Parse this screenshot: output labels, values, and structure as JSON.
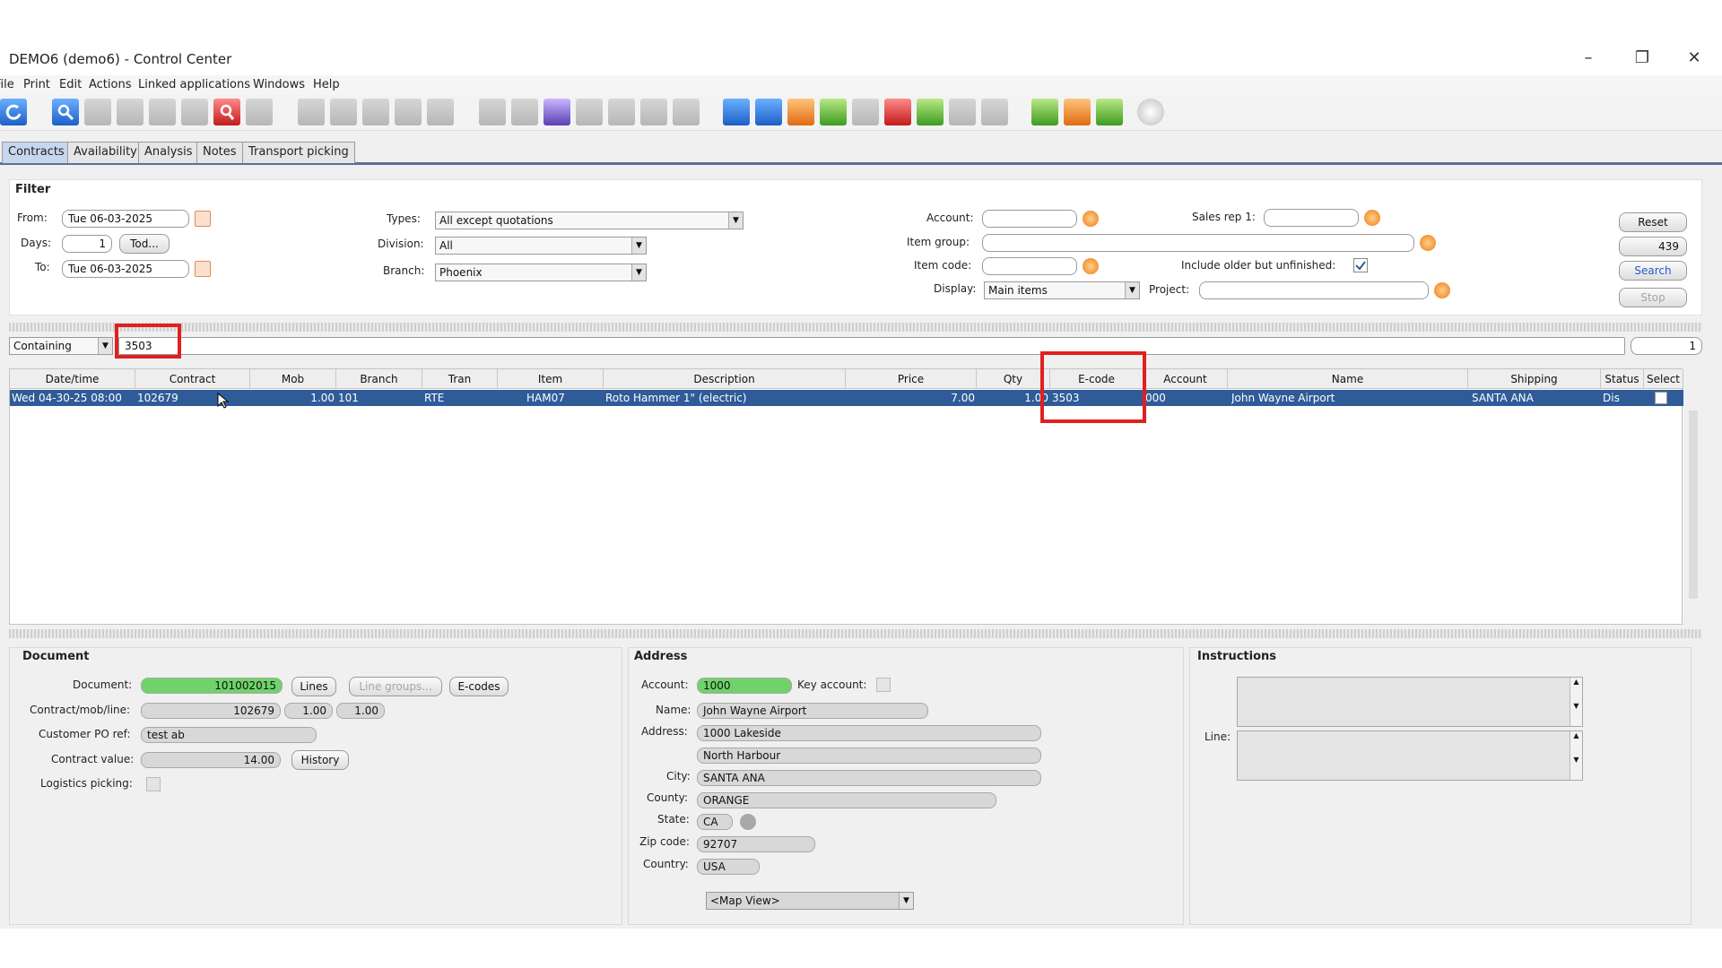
{
  "window": {
    "title": "DEMO6 (demo6) - Control Center"
  },
  "menu": [
    "File",
    "Print",
    "Edit",
    "Actions",
    "Linked applications",
    "Windows",
    "Help"
  ],
  "tabs": [
    {
      "label": "Contracts",
      "active": true
    },
    {
      "label": "Availability"
    },
    {
      "label": "Analysis"
    },
    {
      "label": "Notes"
    },
    {
      "label": "Transport picking"
    }
  ],
  "filter": {
    "title": "Filter",
    "from_label": "From:",
    "from_value": "Tue 06-03-2025",
    "days_label": "Days:",
    "days_value": "1",
    "today_label": "Tod...",
    "to_label": "To:",
    "to_value": "Tue 06-03-2025",
    "types_label": "Types:",
    "types_value": "All except quotations",
    "division_label": "Division:",
    "division_value": "All",
    "branch_label": "Branch:",
    "branch_value": "Phoenix",
    "account_label": "Account:",
    "account_value": "",
    "item_group_label": "Item group:",
    "item_group_value": "",
    "item_code_label": "Item code:",
    "item_code_value": "",
    "display_label": "Display:",
    "display_value": "Main items",
    "sales_rep_label": "Sales rep 1:",
    "sales_rep_value": "",
    "include_older_label": "Include older but unfinished:",
    "include_older_checked": true,
    "project_label": "Project:",
    "project_value": "",
    "reset_label": "Reset",
    "count_value": "439",
    "search_label": "Search",
    "stop_label": "Stop"
  },
  "search": {
    "mode": "Containing",
    "query": "3503",
    "page": "1"
  },
  "grid": {
    "columns": [
      "Date/time",
      "Contract",
      "Mob",
      "Branch",
      "Tran",
      "Item",
      "Description",
      "Price",
      "Qty",
      "E-code",
      "Account",
      "Name",
      "Shipping",
      "Status",
      "Select"
    ],
    "rows": [
      {
        "datetime": "Wed 04-30-25 08:00",
        "contract": "102679",
        "mob": "1.00",
        "branch": "101",
        "tran": "RTE",
        "item": "HAM07",
        "description": "Roto Hammer 1\" (electric)",
        "price": "7.00",
        "qty": "1.00",
        "ecode": "3503",
        "account": "000",
        "name": "John Wayne Airport",
        "shipping": "SANTA ANA",
        "status": "Dis"
      }
    ]
  },
  "document": {
    "title": "Document",
    "document_label": "Document:",
    "document_value": "101002015",
    "lines_label": "Lines",
    "line_groups_label": "Line groups...",
    "ecodes_label": "E-codes",
    "cml_label": "Contract/mob/line:",
    "contract_value": "102679",
    "mob_value": "1.00",
    "line_value": "1.00",
    "po_label": "Customer PO ref:",
    "po_value": "test ab",
    "value_label": "Contract value:",
    "value_value": "14.00",
    "history_label": "History",
    "logistics_label": "Logistics picking:"
  },
  "address": {
    "title": "Address",
    "account_label": "Account:",
    "account_value": "1000",
    "key_account_label": "Key account:",
    "name_label": "Name:",
    "name_value": "John Wayne Airport",
    "address_label": "Address:",
    "address1": "1000 Lakeside",
    "address2": "North Harbour",
    "city_label": "City:",
    "city_value": "SANTA ANA",
    "county_label": "County:",
    "county_value": "ORANGE",
    "state_label": "State:",
    "state_value": "CA",
    "zip_label": "Zip code:",
    "zip_value": "92707",
    "country_label": "Country:",
    "country_value": "USA",
    "map_view": "<Map View>"
  },
  "instructions": {
    "title": "Instructions",
    "line_label": "Line:"
  },
  "colors": {
    "selected_row": "#2f5c99",
    "highlight": "#e0201e",
    "accent_tab": "#c7d6ef",
    "green_field": "#6fd36a"
  }
}
